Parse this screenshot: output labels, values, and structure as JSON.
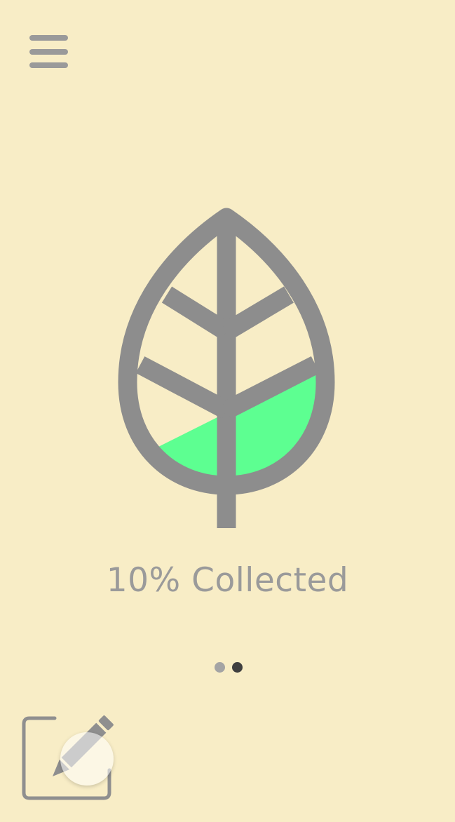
{
  "header": {
    "menu_icon": "hamburger-menu-icon"
  },
  "main": {
    "leaf_icon": "leaf-icon",
    "collected_percent": 10,
    "progress_label": "10% Collected",
    "leaf_outline_color": "#8d8d8d",
    "fill_color": "#5dff91"
  },
  "pagination": {
    "page_count": 2,
    "current_page": 2
  },
  "footer": {
    "compose_icon": "compose-icon"
  }
}
